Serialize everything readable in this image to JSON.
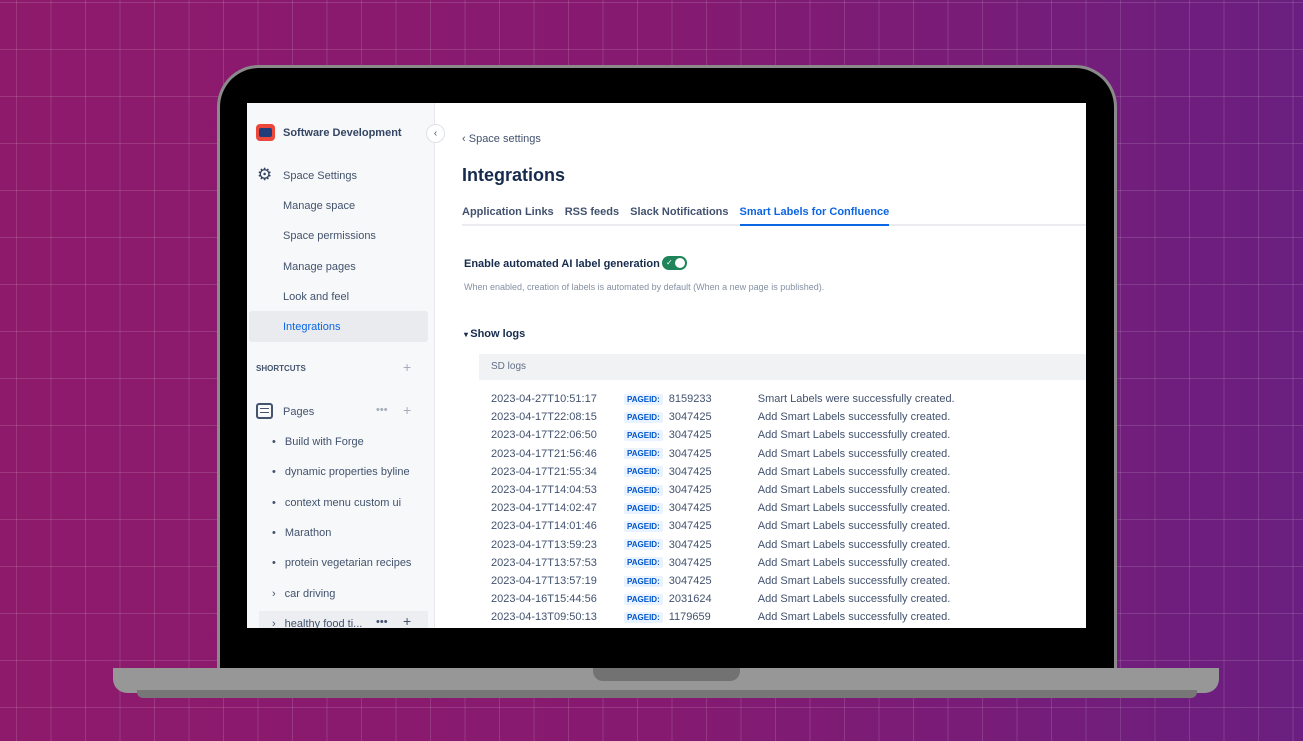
{
  "sidebar": {
    "space_name": "Software Development",
    "settings_label": "Space Settings",
    "settings_items": [
      "Manage space",
      "Space permissions",
      "Manage pages",
      "Look and feel",
      "Integrations"
    ],
    "shortcuts_label": "SHORTCUTS",
    "pages_label": "Pages",
    "pages": [
      {
        "label": "Build with Forge",
        "marker": "•"
      },
      {
        "label": "dynamic properties byline",
        "marker": "•"
      },
      {
        "label": "context menu custom ui",
        "marker": "•"
      },
      {
        "label": "Marathon",
        "marker": "•"
      },
      {
        "label": "protein vegetarian recipes",
        "marker": "•"
      },
      {
        "label": "car driving",
        "marker": "›"
      },
      {
        "label": "healthy food ti...",
        "marker": "›"
      }
    ]
  },
  "main": {
    "breadcrumb": "Space settings",
    "title": "Integrations",
    "tabs": [
      "Application Links",
      "RSS feeds",
      "Slack Notifications",
      "Smart Labels for Confluence"
    ],
    "active_tab": 3,
    "toggle_label": "Enable automated AI label generation",
    "toggle_on": true,
    "toggle_help": "When enabled, creation of labels is automated by default (When a new page is published).",
    "show_logs": "Show logs",
    "logs_title": "SD logs",
    "badge": "PAGEID:",
    "logs": [
      [
        "2023-04-27T10:51:17",
        "8159233",
        "Smart Labels were successfully created."
      ],
      [
        "2023-04-17T22:08:15",
        "3047425",
        "Add Smart Labels successfully created."
      ],
      [
        "2023-04-17T22:06:50",
        "3047425",
        "Add Smart Labels successfully created."
      ],
      [
        "2023-04-17T21:56:46",
        "3047425",
        "Add Smart Labels successfully created."
      ],
      [
        "2023-04-17T21:55:34",
        "3047425",
        "Add Smart Labels successfully created."
      ],
      [
        "2023-04-17T14:04:53",
        "3047425",
        "Add Smart Labels successfully created."
      ],
      [
        "2023-04-17T14:02:47",
        "3047425",
        "Add Smart Labels successfully created."
      ],
      [
        "2023-04-17T14:01:46",
        "3047425",
        "Add Smart Labels successfully created."
      ],
      [
        "2023-04-17T13:59:23",
        "3047425",
        "Add Smart Labels successfully created."
      ],
      [
        "2023-04-17T13:57:53",
        "3047425",
        "Add Smart Labels successfully created."
      ],
      [
        "2023-04-17T13:57:19",
        "3047425",
        "Add Smart Labels successfully created."
      ],
      [
        "2023-04-16T15:44:56",
        "2031624",
        "Add Smart Labels successfully created."
      ],
      [
        "2023-04-13T09:50:13",
        "1179659",
        "Add Smart Labels successfully created."
      ]
    ]
  }
}
